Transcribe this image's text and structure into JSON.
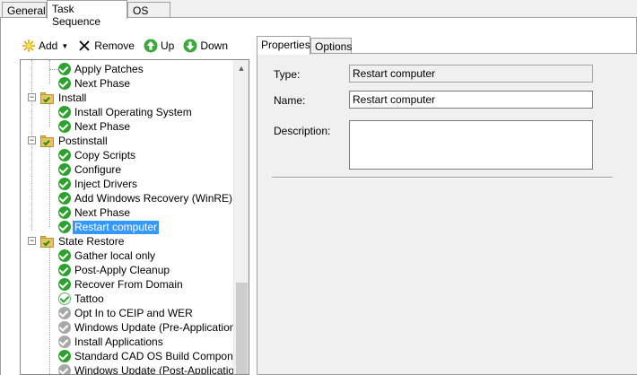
{
  "top_tabs": [
    {
      "label": "General"
    },
    {
      "label": "Task Sequence"
    },
    {
      "label": "OS Info"
    }
  ],
  "toolbar": {
    "add": "Add",
    "remove": "Remove",
    "up": "Up",
    "down": "Down"
  },
  "tree": [
    {
      "label": "Apply Patches",
      "icon": "check-icon"
    },
    {
      "label": "Next Phase",
      "icon": "check-icon"
    },
    {
      "label": "Install",
      "icon": "folder-icon"
    },
    {
      "label": "Install Operating System",
      "icon": "check-icon"
    },
    {
      "label": "Next Phase",
      "icon": "check-icon"
    },
    {
      "label": "Postinstall",
      "icon": "folder-icon"
    },
    {
      "label": "Copy Scripts",
      "icon": "check-icon"
    },
    {
      "label": "Configure",
      "icon": "check-icon"
    },
    {
      "label": "Inject Drivers",
      "icon": "check-icon"
    },
    {
      "label": "Add Windows Recovery (WinRE)",
      "icon": "check-icon"
    },
    {
      "label": "Next Phase",
      "icon": "check-icon"
    },
    {
      "label": "Restart computer",
      "icon": "check-icon",
      "selected": true
    },
    {
      "label": "State Restore",
      "icon": "folder-icon"
    },
    {
      "label": "Gather local only",
      "icon": "check-icon"
    },
    {
      "label": "Post-Apply Cleanup",
      "icon": "check-icon"
    },
    {
      "label": "Recover From Domain",
      "icon": "check-icon"
    },
    {
      "label": "Tattoo",
      "icon": "check-light-icon"
    },
    {
      "label": "Opt In to CEIP and WER",
      "icon": "check-grey-icon"
    },
    {
      "label": "Windows Update (Pre-Application Inst",
      "icon": "check-grey-icon"
    },
    {
      "label": "Install Applications",
      "icon": "check-grey-icon"
    },
    {
      "label": "Standard CAD OS Build Components",
      "icon": "check-icon"
    },
    {
      "label": "Windows Update (Post-Application Ins",
      "icon": "check-grey-icon"
    }
  ],
  "properties": {
    "tabs": [
      {
        "label": "Properties"
      },
      {
        "label": "Options"
      }
    ],
    "type_label": "Type:",
    "type_value": "Restart computer",
    "name_label": "Name:",
    "name_value": "Restart computer",
    "description_label": "Description:",
    "description_value": ""
  }
}
